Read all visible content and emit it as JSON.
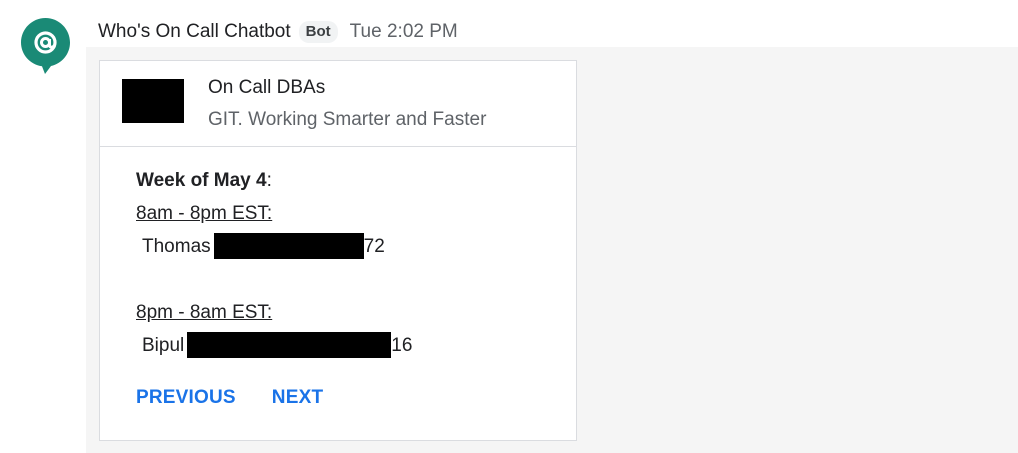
{
  "message": {
    "sender_name": "Who's On Call Chatbot",
    "badge": "Bot",
    "timestamp": "Tue 2:02 PM",
    "avatar_icon": "at-sign-icon",
    "avatar_color": "#1a8a76"
  },
  "card": {
    "title": "On Call DBAs",
    "subtitle": "GIT. Working Smarter and Faster",
    "week_label": "Week of May 4",
    "week_suffix": ":",
    "shifts": [
      {
        "label": "8am - 8pm EST:",
        "person": "Thomas",
        "phone_suffix": "72"
      },
      {
        "label": "8pm - 8am EST:",
        "person": "Bipul",
        "phone_suffix": "16"
      }
    ],
    "actions": {
      "previous": "PREVIOUS",
      "next": "NEXT"
    },
    "accent_color": "#1a73e8"
  }
}
